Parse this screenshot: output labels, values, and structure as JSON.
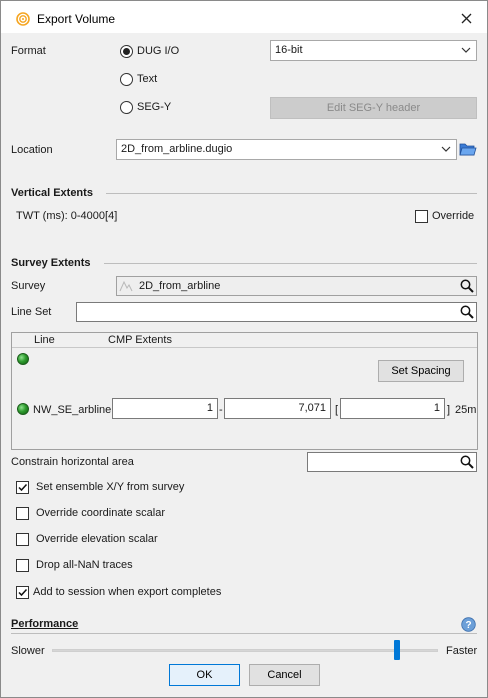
{
  "window": {
    "title": "Export Volume"
  },
  "format": {
    "label": "Format",
    "options": [
      "DUG I/O",
      "Text",
      "SEG-Y"
    ],
    "selected": "DUG I/O",
    "bit_depth": "16-bit",
    "edit_segy_label": "Edit SEG-Y header"
  },
  "location": {
    "label": "Location",
    "value": "2D_from_arbline.dugio"
  },
  "vertical": {
    "title": "Vertical Extents",
    "range_text": "TWT (ms): 0-4000[4]",
    "override_label": "Override"
  },
  "survey": {
    "title": "Survey Extents",
    "survey_label": "Survey",
    "survey_value": "2D_from_arbline",
    "lineset_label": "Line Set",
    "lineset_value": "",
    "col_line": "Line",
    "col_cmp": "CMP Extents",
    "set_spacing_label": "Set Spacing",
    "row": {
      "name": "NW_SE_arbline",
      "start": "1",
      "end": "7,071",
      "step": "1",
      "spacing": "25m"
    },
    "constrain_label": "Constrain horizontal area"
  },
  "options": [
    {
      "label": "Set ensemble X/Y from survey",
      "checked": true
    },
    {
      "label": "Override coordinate scalar",
      "checked": false
    },
    {
      "label": "Override elevation scalar",
      "checked": false
    },
    {
      "label": "Drop all-NaN traces",
      "checked": false
    },
    {
      "label": "Add to session when export completes",
      "checked": true
    }
  ],
  "performance": {
    "title": "Performance",
    "slower": "Slower",
    "faster": "Faster",
    "level": 0.9
  },
  "buttons": {
    "ok": "OK",
    "cancel": "Cancel"
  },
  "colors": {
    "accent": "#0078d7",
    "status_green": "#2e9b2e",
    "app_icon": "#f5a623"
  }
}
